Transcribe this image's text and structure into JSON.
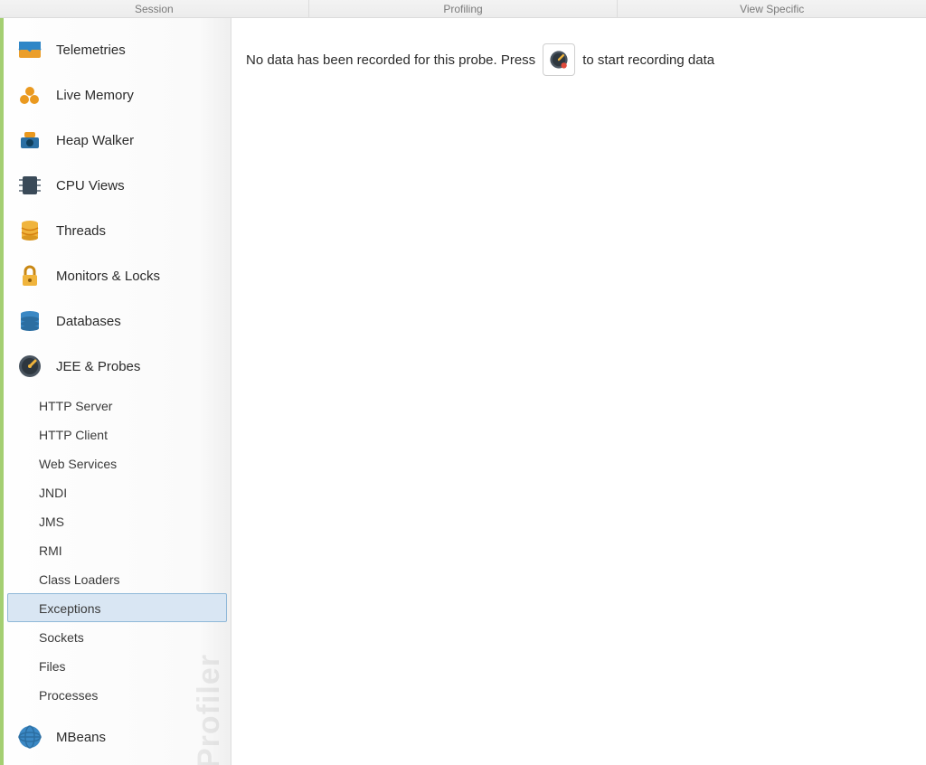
{
  "menus": {
    "session": "Session",
    "profiling": "Profiling",
    "view_specific": "View Specific"
  },
  "sidebar": {
    "watermark": "Profiler",
    "items": {
      "telemetries": {
        "label": "Telemetries"
      },
      "live_memory": {
        "label": "Live Memory"
      },
      "heap_walker": {
        "label": "Heap Walker"
      },
      "cpu_views": {
        "label": "CPU Views"
      },
      "threads": {
        "label": "Threads"
      },
      "monitors_locks": {
        "label": "Monitors & Locks"
      },
      "databases": {
        "label": "Databases"
      },
      "jee_probes": {
        "label": "JEE & Probes"
      },
      "mbeans": {
        "label": "MBeans"
      }
    },
    "probes": {
      "http_server": "HTTP Server",
      "http_client": "HTTP Client",
      "web_services": "Web Services",
      "jndi": "JNDI",
      "jms": "JMS",
      "rmi": "RMI",
      "class_loaders": "Class Loaders",
      "exceptions": "Exceptions",
      "sockets": "Sockets",
      "files": "Files",
      "processes": "Processes"
    },
    "selected_probe": "exceptions"
  },
  "content": {
    "message_before": "No data has been recorded for this probe. Press",
    "message_after": "to start recording data",
    "record_button_name": "record-probe-button"
  }
}
